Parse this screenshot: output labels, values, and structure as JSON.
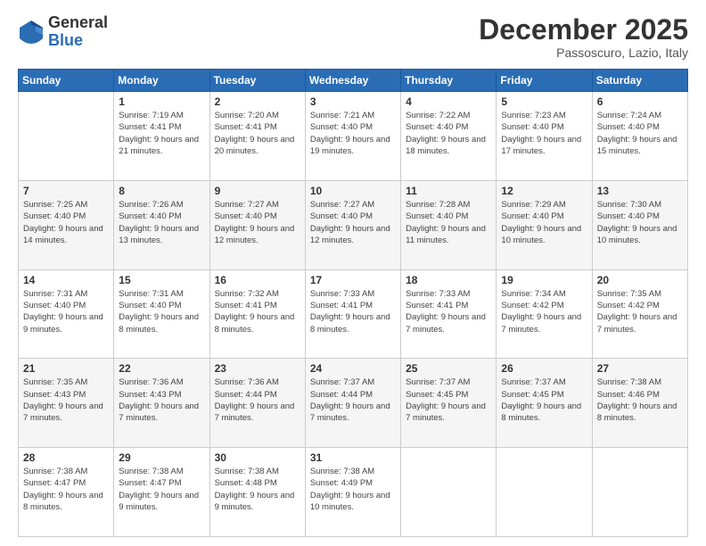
{
  "logo": {
    "general": "General",
    "blue": "Blue"
  },
  "title": "December 2025",
  "location": "Passoscuro, Lazio, Italy",
  "days_of_week": [
    "Sunday",
    "Monday",
    "Tuesday",
    "Wednesday",
    "Thursday",
    "Friday",
    "Saturday"
  ],
  "weeks": [
    [
      {
        "day": "",
        "sunrise": "",
        "sunset": "",
        "daylight": ""
      },
      {
        "day": "1",
        "sunrise": "Sunrise: 7:19 AM",
        "sunset": "Sunset: 4:41 PM",
        "daylight": "Daylight: 9 hours and 21 minutes."
      },
      {
        "day": "2",
        "sunrise": "Sunrise: 7:20 AM",
        "sunset": "Sunset: 4:41 PM",
        "daylight": "Daylight: 9 hours and 20 minutes."
      },
      {
        "day": "3",
        "sunrise": "Sunrise: 7:21 AM",
        "sunset": "Sunset: 4:40 PM",
        "daylight": "Daylight: 9 hours and 19 minutes."
      },
      {
        "day": "4",
        "sunrise": "Sunrise: 7:22 AM",
        "sunset": "Sunset: 4:40 PM",
        "daylight": "Daylight: 9 hours and 18 minutes."
      },
      {
        "day": "5",
        "sunrise": "Sunrise: 7:23 AM",
        "sunset": "Sunset: 4:40 PM",
        "daylight": "Daylight: 9 hours and 17 minutes."
      },
      {
        "day": "6",
        "sunrise": "Sunrise: 7:24 AM",
        "sunset": "Sunset: 4:40 PM",
        "daylight": "Daylight: 9 hours and 15 minutes."
      }
    ],
    [
      {
        "day": "7",
        "sunrise": "Sunrise: 7:25 AM",
        "sunset": "Sunset: 4:40 PM",
        "daylight": "Daylight: 9 hours and 14 minutes."
      },
      {
        "day": "8",
        "sunrise": "Sunrise: 7:26 AM",
        "sunset": "Sunset: 4:40 PM",
        "daylight": "Daylight: 9 hours and 13 minutes."
      },
      {
        "day": "9",
        "sunrise": "Sunrise: 7:27 AM",
        "sunset": "Sunset: 4:40 PM",
        "daylight": "Daylight: 9 hours and 12 minutes."
      },
      {
        "day": "10",
        "sunrise": "Sunrise: 7:27 AM",
        "sunset": "Sunset: 4:40 PM",
        "daylight": "Daylight: 9 hours and 12 minutes."
      },
      {
        "day": "11",
        "sunrise": "Sunrise: 7:28 AM",
        "sunset": "Sunset: 4:40 PM",
        "daylight": "Daylight: 9 hours and 11 minutes."
      },
      {
        "day": "12",
        "sunrise": "Sunrise: 7:29 AM",
        "sunset": "Sunset: 4:40 PM",
        "daylight": "Daylight: 9 hours and 10 minutes."
      },
      {
        "day": "13",
        "sunrise": "Sunrise: 7:30 AM",
        "sunset": "Sunset: 4:40 PM",
        "daylight": "Daylight: 9 hours and 10 minutes."
      }
    ],
    [
      {
        "day": "14",
        "sunrise": "Sunrise: 7:31 AM",
        "sunset": "Sunset: 4:40 PM",
        "daylight": "Daylight: 9 hours and 9 minutes."
      },
      {
        "day": "15",
        "sunrise": "Sunrise: 7:31 AM",
        "sunset": "Sunset: 4:40 PM",
        "daylight": "Daylight: 9 hours and 8 minutes."
      },
      {
        "day": "16",
        "sunrise": "Sunrise: 7:32 AM",
        "sunset": "Sunset: 4:41 PM",
        "daylight": "Daylight: 9 hours and 8 minutes."
      },
      {
        "day": "17",
        "sunrise": "Sunrise: 7:33 AM",
        "sunset": "Sunset: 4:41 PM",
        "daylight": "Daylight: 9 hours and 8 minutes."
      },
      {
        "day": "18",
        "sunrise": "Sunrise: 7:33 AM",
        "sunset": "Sunset: 4:41 PM",
        "daylight": "Daylight: 9 hours and 7 minutes."
      },
      {
        "day": "19",
        "sunrise": "Sunrise: 7:34 AM",
        "sunset": "Sunset: 4:42 PM",
        "daylight": "Daylight: 9 hours and 7 minutes."
      },
      {
        "day": "20",
        "sunrise": "Sunrise: 7:35 AM",
        "sunset": "Sunset: 4:42 PM",
        "daylight": "Daylight: 9 hours and 7 minutes."
      }
    ],
    [
      {
        "day": "21",
        "sunrise": "Sunrise: 7:35 AM",
        "sunset": "Sunset: 4:43 PM",
        "daylight": "Daylight: 9 hours and 7 minutes."
      },
      {
        "day": "22",
        "sunrise": "Sunrise: 7:36 AM",
        "sunset": "Sunset: 4:43 PM",
        "daylight": "Daylight: 9 hours and 7 minutes."
      },
      {
        "day": "23",
        "sunrise": "Sunrise: 7:36 AM",
        "sunset": "Sunset: 4:44 PM",
        "daylight": "Daylight: 9 hours and 7 minutes."
      },
      {
        "day": "24",
        "sunrise": "Sunrise: 7:37 AM",
        "sunset": "Sunset: 4:44 PM",
        "daylight": "Daylight: 9 hours and 7 minutes."
      },
      {
        "day": "25",
        "sunrise": "Sunrise: 7:37 AM",
        "sunset": "Sunset: 4:45 PM",
        "daylight": "Daylight: 9 hours and 7 minutes."
      },
      {
        "day": "26",
        "sunrise": "Sunrise: 7:37 AM",
        "sunset": "Sunset: 4:45 PM",
        "daylight": "Daylight: 9 hours and 8 minutes."
      },
      {
        "day": "27",
        "sunrise": "Sunrise: 7:38 AM",
        "sunset": "Sunset: 4:46 PM",
        "daylight": "Daylight: 9 hours and 8 minutes."
      }
    ],
    [
      {
        "day": "28",
        "sunrise": "Sunrise: 7:38 AM",
        "sunset": "Sunset: 4:47 PM",
        "daylight": "Daylight: 9 hours and 8 minutes."
      },
      {
        "day": "29",
        "sunrise": "Sunrise: 7:38 AM",
        "sunset": "Sunset: 4:47 PM",
        "daylight": "Daylight: 9 hours and 9 minutes."
      },
      {
        "day": "30",
        "sunrise": "Sunrise: 7:38 AM",
        "sunset": "Sunset: 4:48 PM",
        "daylight": "Daylight: 9 hours and 9 minutes."
      },
      {
        "day": "31",
        "sunrise": "Sunrise: 7:38 AM",
        "sunset": "Sunset: 4:49 PM",
        "daylight": "Daylight: 9 hours and 10 minutes."
      },
      {
        "day": "",
        "sunrise": "",
        "sunset": "",
        "daylight": ""
      },
      {
        "day": "",
        "sunrise": "",
        "sunset": "",
        "daylight": ""
      },
      {
        "day": "",
        "sunrise": "",
        "sunset": "",
        "daylight": ""
      }
    ]
  ]
}
